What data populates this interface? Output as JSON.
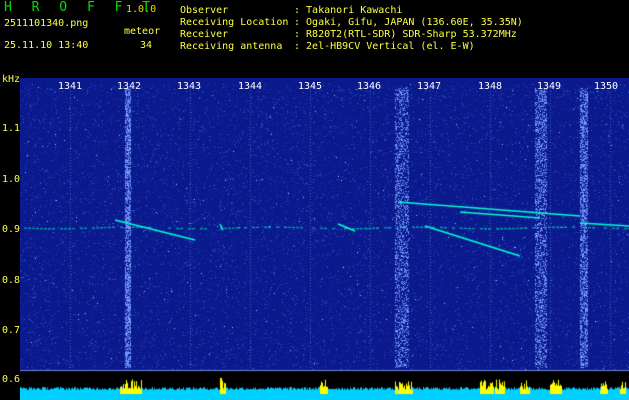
{
  "app": {
    "name": "H R O F F T",
    "version": "1.0.0"
  },
  "file": {
    "name": "2511101340.png",
    "datetime": "25.11.10 13:40"
  },
  "counter": {
    "label": "meteor",
    "value": "34"
  },
  "info": [
    {
      "label": "Observer",
      "value": ": Takanori Kawachi"
    },
    {
      "label": "Receiving Location",
      "value": ": Ogaki, Gifu, JAPAN (136.60E, 35.35N)"
    },
    {
      "label": "Receiver",
      "value": ": R820T2(RTL-SDR) SDR-Sharp 53.372MHz"
    },
    {
      "label": "Receiving antenna",
      "value": ": 2el-HB9CV Vertical (el. E-W)"
    }
  ],
  "axes": {
    "y_unit": "kHz",
    "x_ticks": [
      "1341",
      "1342",
      "1343",
      "1344",
      "1345",
      "1346",
      "1347",
      "1348",
      "1349",
      "1350"
    ],
    "y_ticks": [
      "1.1",
      "1.0",
      "0.9",
      "0.8",
      "0.7",
      "0.6"
    ]
  },
  "colors": {
    "background": "#000000",
    "spectrogram_base": "#0a1a8c",
    "noise_light": "#3a5ae0",
    "signal": "#00ffd0",
    "amplitude_bar": "#00d0ff",
    "amplitude_peak": "#ffff00",
    "title_green": "#00e000",
    "label_yellow": "#ffff40",
    "tick_white": "#ffffff"
  }
}
